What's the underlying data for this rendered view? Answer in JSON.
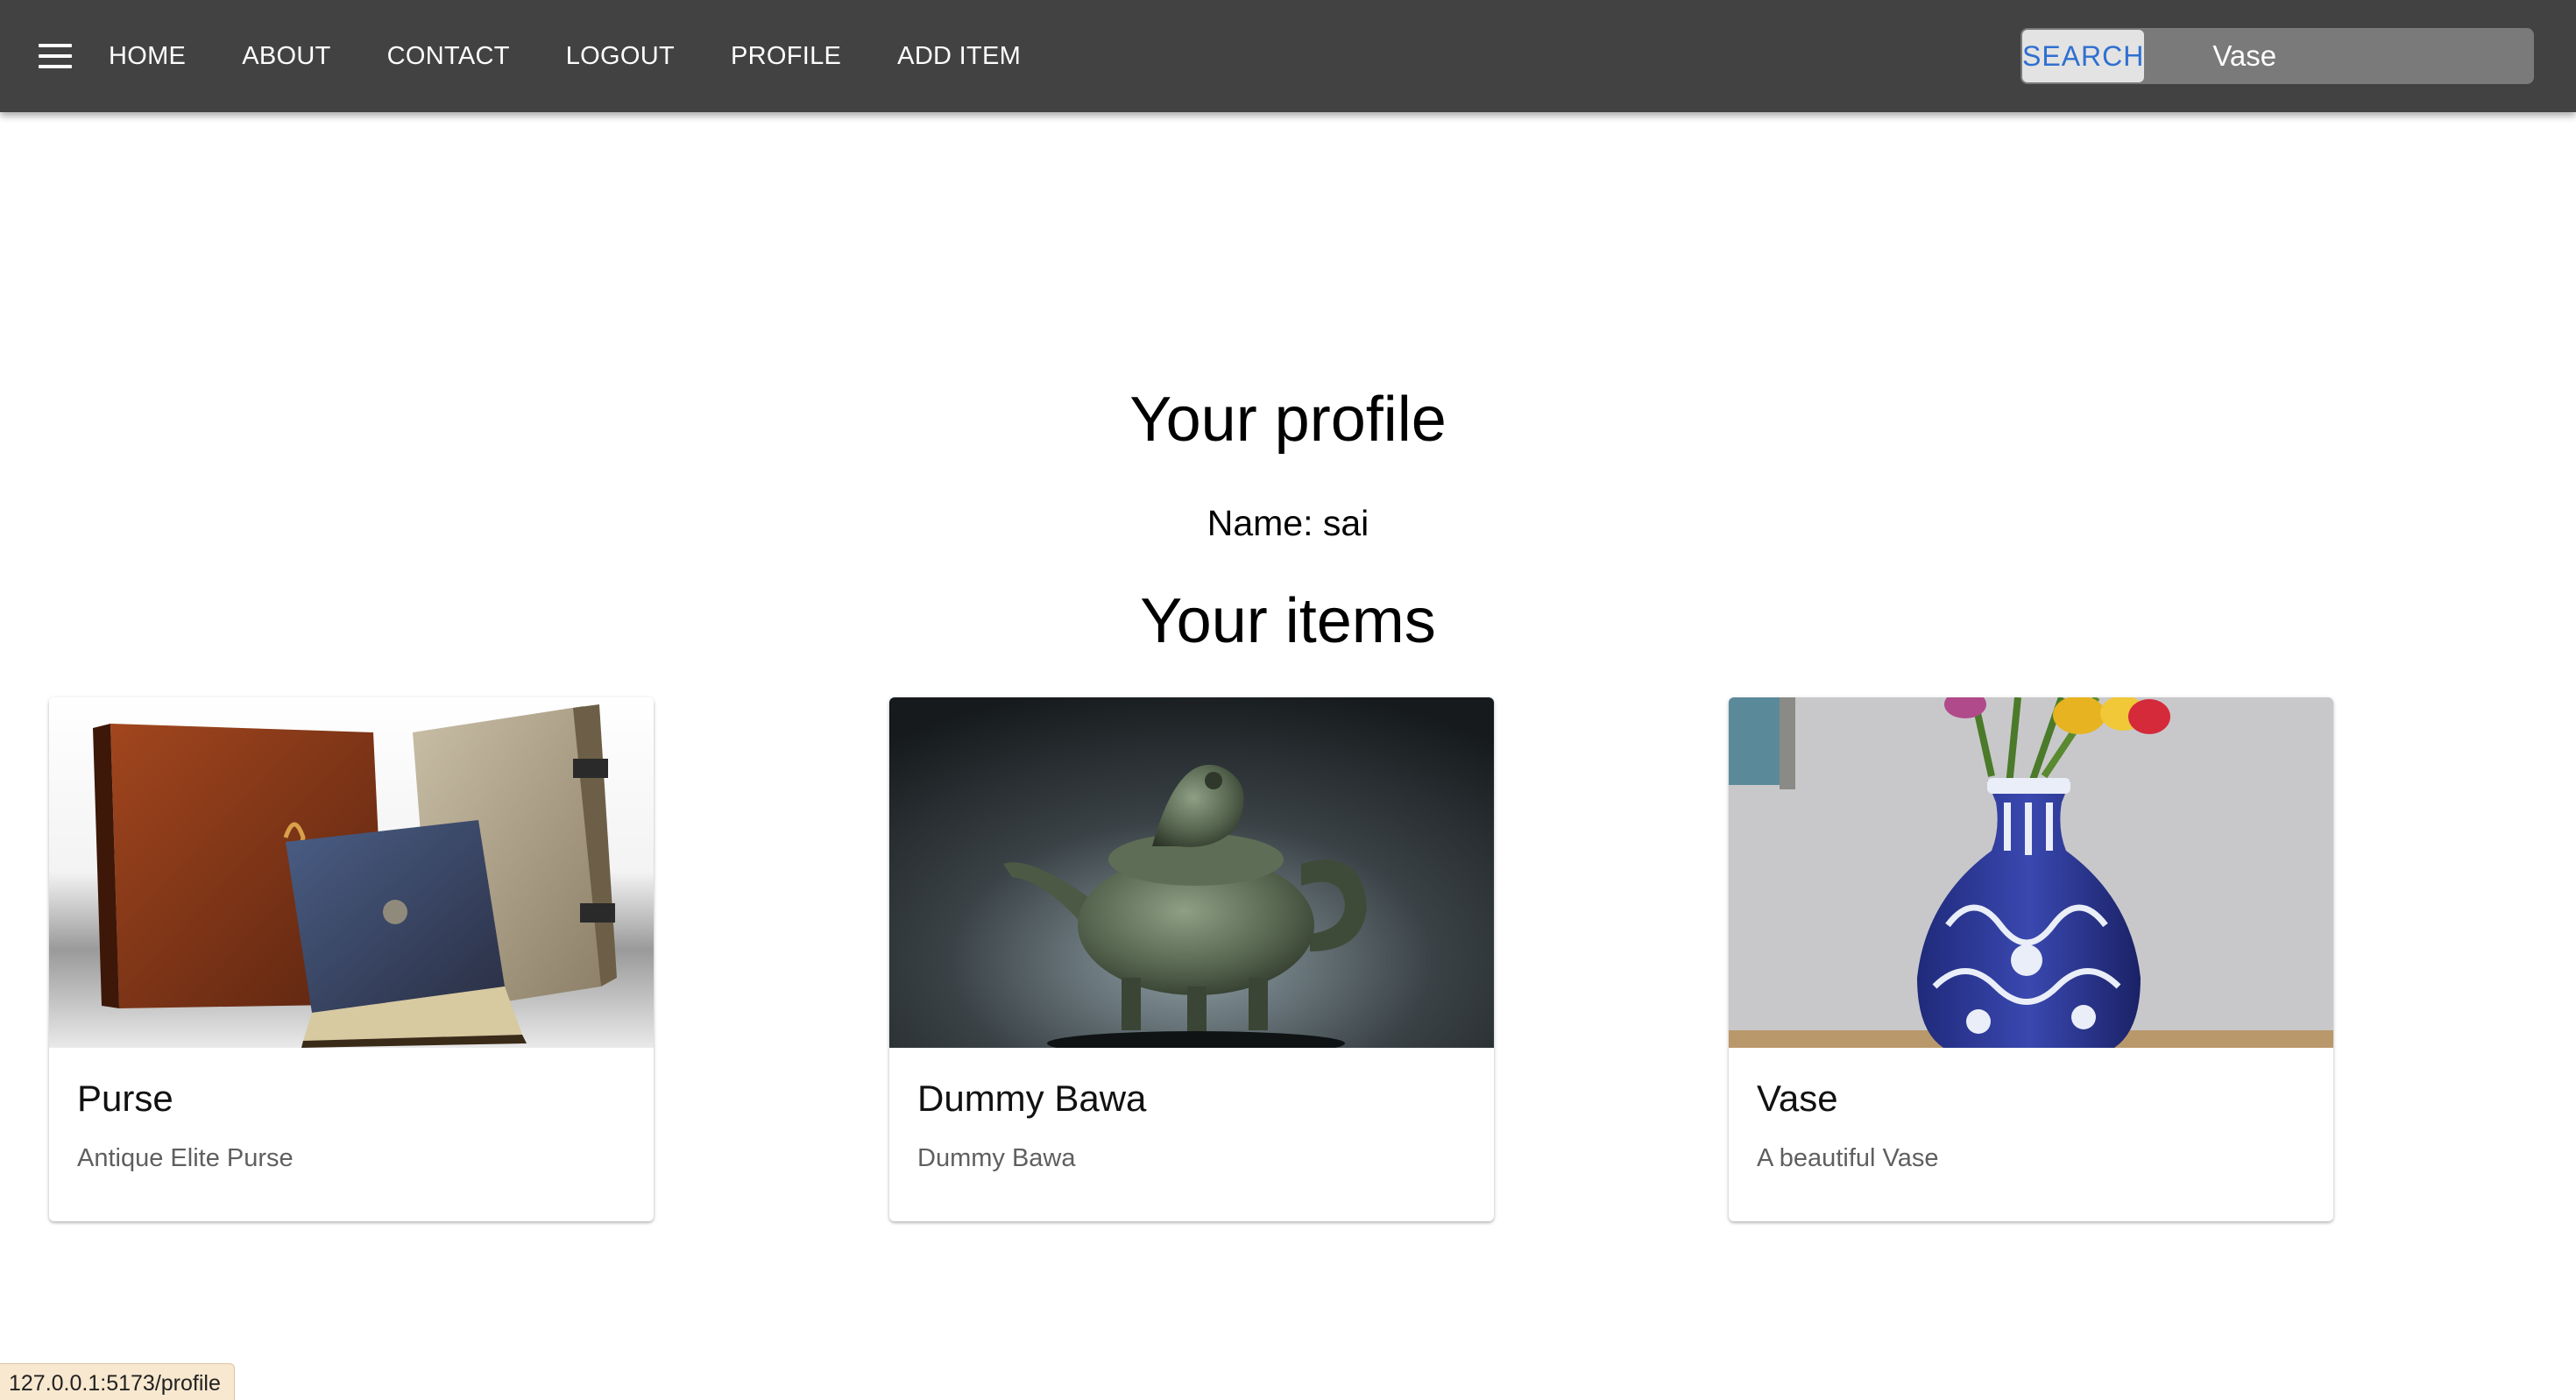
{
  "nav": {
    "links": [
      "HOME",
      "ABOUT",
      "CONTACT",
      "LOGOUT",
      "PROFILE",
      "ADD ITEM"
    ],
    "search_label": "SEARCH",
    "search_value": "Vase",
    "menu_icon": "menu-icon"
  },
  "profile": {
    "title": "Your profile",
    "name": "Name: sai",
    "items_title": "Your items"
  },
  "items": [
    {
      "title": "Purse",
      "description": "Antique Elite Purse",
      "image": "antique-books-photo"
    },
    {
      "title": "Dummy Bawa",
      "description": "Dummy Bawa",
      "image": "bronze-teapot-photo"
    },
    {
      "title": "Vase",
      "description": "A beautiful Vase",
      "image": "blue-vase-photo"
    }
  ],
  "status_bar": {
    "url": "127.0.0.1:5173/profile"
  },
  "colors": {
    "appbar": "#424242",
    "search_text": "#2f6fd0",
    "page_background": "#ffffff"
  }
}
